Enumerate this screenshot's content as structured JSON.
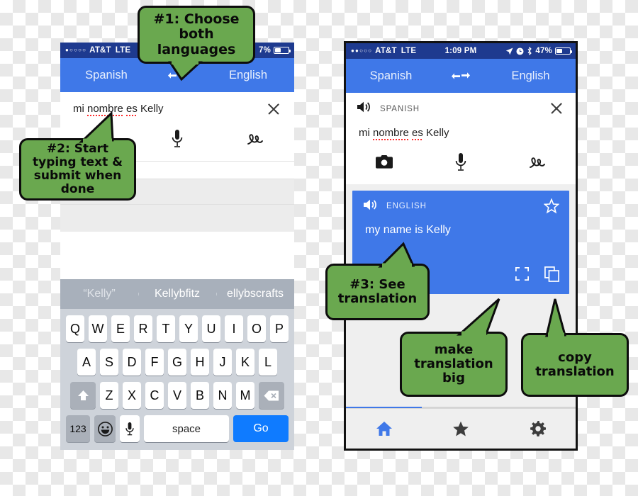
{
  "phone_left": {
    "status": {
      "signal_dots": "●○○○○",
      "carrier": "AT&T",
      "network": "LTE",
      "time": "",
      "battery_pct": "7%",
      "battery_level": 47
    },
    "header": {
      "source_lang": "Spanish",
      "target_lang": "English",
      "swap_icon": "swap-horizontal-icon"
    },
    "input": {
      "text_before": "mi ",
      "misspelled_1": "nombre",
      "text_mid": " ",
      "misspelled_2": "es",
      "text_after": " Kelly",
      "clear_icon": "close-icon"
    },
    "tools": [
      {
        "name": "camera-icon",
        "label": "camera"
      },
      {
        "name": "microphone-icon",
        "label": "microphone"
      },
      {
        "name": "handwriting-icon",
        "label": "handwriting"
      }
    ],
    "keyboard": {
      "predictions": [
        "“Kelly”",
        "Kellybfitz",
        "ellybscrafts"
      ],
      "row1": [
        "Q",
        "W",
        "E",
        "R",
        "T",
        "Y",
        "U",
        "I",
        "O",
        "P"
      ],
      "row2": [
        "A",
        "S",
        "D",
        "F",
        "G",
        "H",
        "J",
        "K",
        "L"
      ],
      "row3": [
        "Z",
        "X",
        "C",
        "V",
        "B",
        "N",
        "M"
      ],
      "shift_label": "shift-icon",
      "backspace_label": "backspace-icon",
      "numbers_label": "123",
      "emoji_label": "☺",
      "dictation_label": "microphone-icon",
      "space_label": "space",
      "go_label": "Go"
    }
  },
  "phone_right": {
    "status": {
      "signal_dots": "●●○○○",
      "carrier": "AT&T",
      "network": "LTE",
      "time": "1:09 PM",
      "battery_pct": "47%",
      "battery_level": 47,
      "icons": [
        "location-arrow-icon",
        "alarm-clock-icon",
        "bluetooth-icon"
      ]
    },
    "header": {
      "source_lang": "Spanish",
      "target_lang": "English",
      "swap_icon": "swap-horizontal-icon"
    },
    "source_card": {
      "speaker_icon": "speaker-icon",
      "language_label": "SPANISH",
      "clear_icon": "close-icon",
      "text_before": "mi ",
      "misspelled_1": "nombre",
      "text_mid": " ",
      "misspelled_2": "es",
      "text_after": " Kelly"
    },
    "tools": [
      {
        "name": "camera-icon",
        "label": "camera"
      },
      {
        "name": "microphone-icon",
        "label": "microphone"
      },
      {
        "name": "handwriting-icon",
        "label": "handwriting"
      }
    ],
    "translation_card": {
      "speaker_icon": "speaker-icon",
      "language_label": "ENGLISH",
      "star_icon": "star-outline-icon",
      "translation": "my name is Kelly",
      "fullscreen_icon": "fullscreen-icon",
      "copy_icon": "copy-icon",
      "background_color": "#3f78e8"
    },
    "progress_percent": 33,
    "nav": [
      {
        "name": "nav-home",
        "icon": "home-icon",
        "active": true
      },
      {
        "name": "nav-starred",
        "icon": "star-filled-icon",
        "active": false
      },
      {
        "name": "nav-settings",
        "icon": "gear-icon",
        "active": false
      }
    ]
  },
  "callouts": [
    {
      "id": "callout-1",
      "text": "#1: Choose both languages"
    },
    {
      "id": "callout-2",
      "text": "#2: Start typing text & submit when done"
    },
    {
      "id": "callout-3",
      "text": "#3: See translation"
    },
    {
      "id": "callout-4",
      "text": "make translation big"
    },
    {
      "id": "callout-5",
      "text": "copy translation"
    }
  ],
  "colors": {
    "brand_blue": "#3f78e8",
    "status_blue": "#1e3a8f",
    "callout_green": "#6aa84f",
    "go_blue": "#0f7bff"
  }
}
